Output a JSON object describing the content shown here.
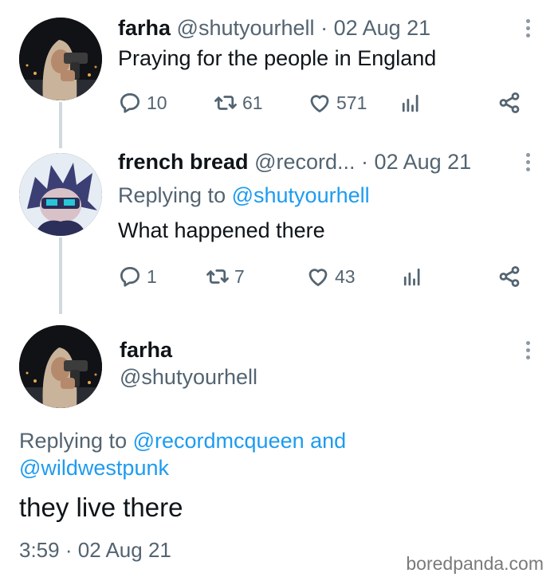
{
  "tweet1": {
    "name": "farha",
    "handle": "@shutyourhell",
    "separator": "·",
    "date": "02 Aug 21",
    "text": "Praying for the people in England",
    "replies": "10",
    "retweets": "61",
    "likes": "571"
  },
  "tweet2": {
    "name": "french bread",
    "handle": "@record...",
    "separator": "·",
    "date": "02 Aug 21",
    "replying_label": "Replying to",
    "replying_handle": "@shutyourhell",
    "text": "What happened there",
    "replies": "1",
    "retweets": "7",
    "likes": "43"
  },
  "tweet3": {
    "name": "farha",
    "handle": "@shutyourhell",
    "replying_label": "Replying to",
    "replying_handle_1": "@recordmcqueen",
    "replying_and": "and",
    "replying_handle_2": "@wildwestpunk",
    "text": "they live there",
    "time": "3:59",
    "separator": "·",
    "date": "02 Aug 21"
  },
  "watermark": "boredpanda.com",
  "icons": {
    "reply": "reply-icon",
    "retweet": "retweet-icon",
    "like": "heart-icon",
    "views": "analytics-icon",
    "share": "share-icon",
    "more": "more-vertical-icon"
  },
  "colors": {
    "text": "#0f1419",
    "secondary": "#536471",
    "link": "#1d9bf0",
    "thread_line": "#cfd9de"
  }
}
